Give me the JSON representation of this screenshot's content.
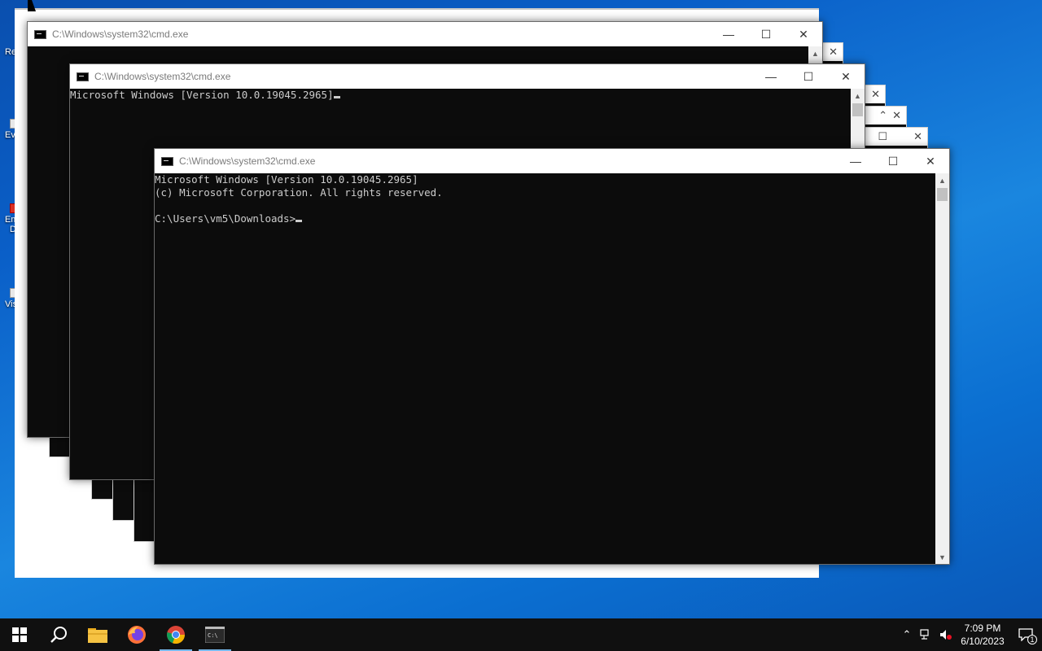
{
  "desktop": {
    "icons": [
      {
        "label": "Re"
      },
      {
        "label": "Ev"
      },
      {
        "label": "Em"
      },
      {
        "label": "D"
      },
      {
        "label": "Vis"
      }
    ]
  },
  "windows": {
    "back": {
      "title": "C:\\Windows\\system32\\cmd.exe"
    },
    "middle": {
      "title": "C:\\Windows\\system32\\cmd.exe",
      "line1": "Microsoft Windows [Version 10.0.19045.2965]"
    },
    "front": {
      "title": "C:\\Windows\\system32\\cmd.exe",
      "line1": "Microsoft Windows [Version 10.0.19045.2965]",
      "line2": "(c) Microsoft Corporation. All rights reserved.",
      "line3": "",
      "prompt": "C:\\Users\\vm5\\Downloads>"
    },
    "controls": {
      "minimize": "—",
      "maximize": "☐",
      "close": "✕"
    }
  },
  "taskbar": {
    "apps": [
      {
        "name": "start",
        "icon": "windows-logo-icon"
      },
      {
        "name": "search",
        "icon": "search-icon"
      },
      {
        "name": "file-explorer",
        "icon": "folder-icon"
      },
      {
        "name": "firefox",
        "icon": "firefox-icon"
      },
      {
        "name": "chrome",
        "icon": "chrome-icon"
      },
      {
        "name": "command-prompt",
        "icon": "cmd-icon"
      }
    ],
    "clock": {
      "time": "7:09 PM",
      "date": "6/10/2023"
    },
    "notification_count": "1",
    "colors": {
      "background": "#101010",
      "active_indicator": "#76b9ed"
    }
  }
}
